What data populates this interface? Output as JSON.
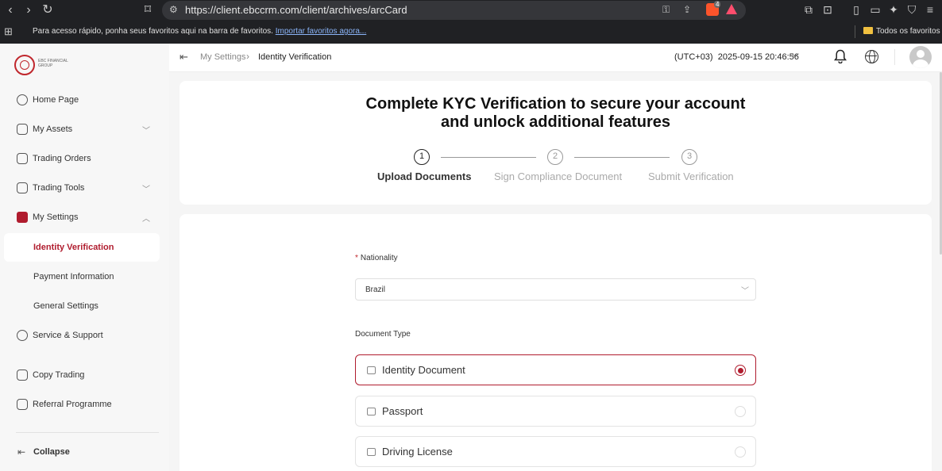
{
  "browser": {
    "url": "https://client.ebccrm.com/client/archives/arcCard",
    "brave_shield_count": "4",
    "bookmarks_bar": {
      "message": "Para acesso rápido, ponha seus favoritos aqui na barra de favoritos.",
      "import_link": "Importar favoritos agora...",
      "all_favorites": "Todos os favoritos"
    }
  },
  "sidebar": {
    "logo_text": "EBC FINANCIAL GROUP",
    "items": [
      {
        "label": "Home Page",
        "icon": "home-icon"
      },
      {
        "label": "My Assets",
        "icon": "assets-icon"
      },
      {
        "label": "Trading Orders",
        "icon": "orders-icon"
      },
      {
        "label": "Trading Tools",
        "icon": "tools-icon"
      },
      {
        "label": "My Settings",
        "icon": "settings-icon"
      },
      {
        "label": "Service & Support",
        "icon": "support-icon"
      },
      {
        "label": "Copy Trading",
        "icon": "copy-trading-icon"
      },
      {
        "label": "Referral Programme",
        "icon": "referral-icon"
      }
    ],
    "settings_sub": [
      "Identity Verification",
      "Payment Information",
      "General Settings"
    ],
    "active_color": "#b01c2e",
    "collapse_label": "Collapse"
  },
  "header": {
    "breadcrumb_parent": "My Settings",
    "breadcrumb_current": "Identity Verification",
    "timezone": "(UTC+03)",
    "datetime": "2025-09-15 20:46:56"
  },
  "kyc": {
    "title_line1": "Complete KYC Verification to secure your account",
    "title_line2": "and unlock additional features",
    "steps": [
      {
        "number": "1",
        "label": "Upload Documents"
      },
      {
        "number": "2",
        "label": "Sign Compliance Document"
      },
      {
        "number": "3",
        "label": "Submit Verification"
      }
    ],
    "current_step": 1
  },
  "form": {
    "nationality_label": "Nationality",
    "nationality_value": "Brazil",
    "document_type_label": "Document Type",
    "document_options": [
      "Identity Document",
      "Passport",
      "Driving License"
    ],
    "selected_document": "Identity Document"
  }
}
